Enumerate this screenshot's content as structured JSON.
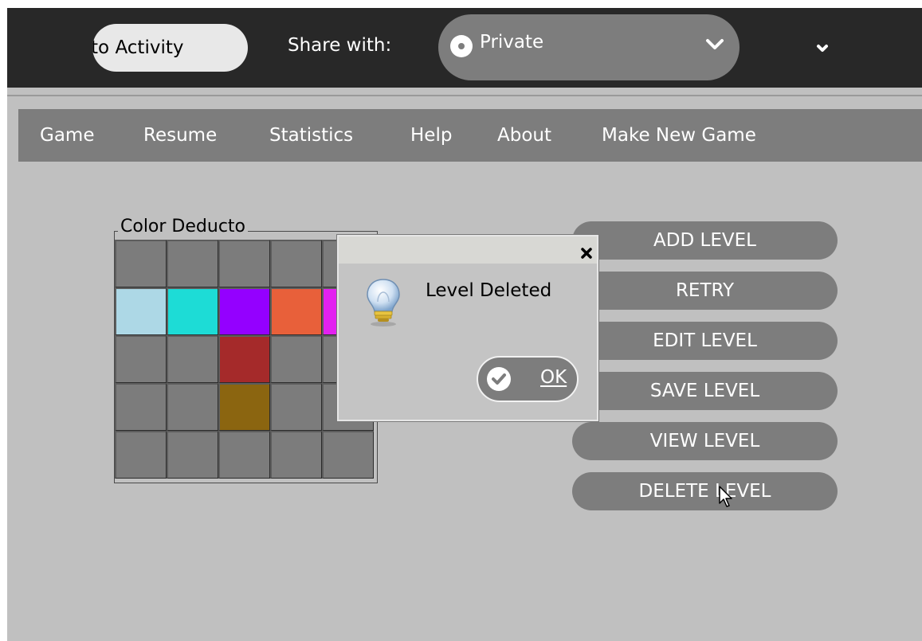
{
  "toolbar": {
    "activity_title": "Color Deducto Activity",
    "share_label": "Share with:",
    "share_value": "Private"
  },
  "menu": {
    "items": [
      "Game",
      "Resume",
      "Statistics",
      "Help",
      "About",
      "Make New Game"
    ]
  },
  "board": {
    "title": "Color Deducto",
    "rows": [
      [
        "#7c7c7c",
        "#7c7c7c",
        "#7c7c7c",
        "#7c7c7c",
        "#7c7c7c"
      ],
      [
        "#add8e6",
        "#1ddcd6",
        "#9400ff",
        "#e8603a",
        "#e321f0"
      ],
      [
        "#7c7c7c",
        "#7c7c7c",
        "#a52a2a",
        "#7c7c7c",
        "#7c7c7c"
      ],
      [
        "#7c7c7c",
        "#7c7c7c",
        "#8b6510",
        "#7c7c7c",
        "#7c7c7c"
      ],
      [
        "#7c7c7c",
        "#7c7c7c",
        "#7c7c7c",
        "#7c7c7c",
        "#7c7c7c"
      ]
    ]
  },
  "side_buttons": {
    "add": "ADD LEVEL",
    "retry": "RETRY",
    "edit": "EDIT LEVEL",
    "save": "SAVE LEVEL",
    "view": "VIEW LEVEL",
    "delete": "DELETE LEVEL"
  },
  "dialog": {
    "message": "Level Deleted",
    "ok_label": "OK",
    "icon": "lightbulb-icon"
  },
  "colors": {
    "toolbar_bg": "#282828",
    "menubar_bg": "#7d7d7d",
    "canvas_bg": "#c0c0c0",
    "button_bg": "#7d7d7d"
  }
}
